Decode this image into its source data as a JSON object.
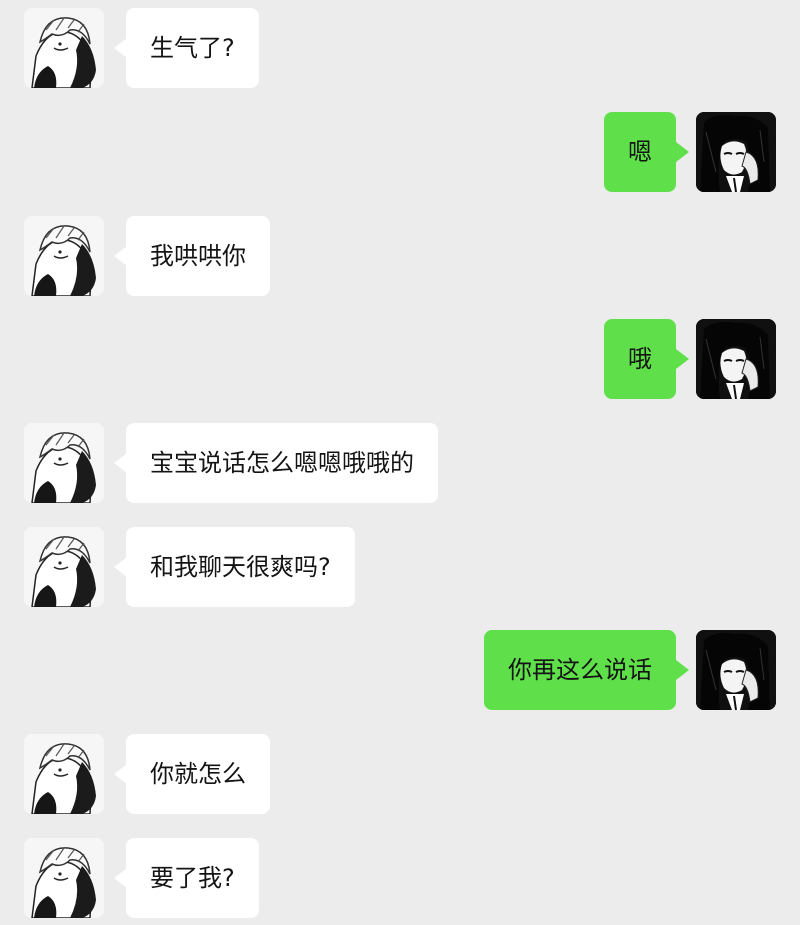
{
  "chat": {
    "messages": [
      {
        "sender": "other",
        "text": "生气了?"
      },
      {
        "sender": "me",
        "text": "嗯"
      },
      {
        "sender": "other",
        "text": "我哄哄你"
      },
      {
        "sender": "me",
        "text": "哦"
      },
      {
        "sender": "other",
        "text": "宝宝说话怎么嗯嗯哦哦的"
      },
      {
        "sender": "other",
        "text": "和我聊天很爽吗?"
      },
      {
        "sender": "me",
        "text": "你再这么说话"
      },
      {
        "sender": "other",
        "text": "你就怎么"
      },
      {
        "sender": "other",
        "text": "要了我?"
      }
    ]
  },
  "colors": {
    "background": "#ececec",
    "incoming_bubble": "#ffffff",
    "outgoing_bubble": "#5fe04a",
    "text": "#141414"
  },
  "icons": {
    "incoming_avatar": "manga-light-haired-avatar-icon",
    "outgoing_avatar": "manga-dark-haired-avatar-icon"
  }
}
